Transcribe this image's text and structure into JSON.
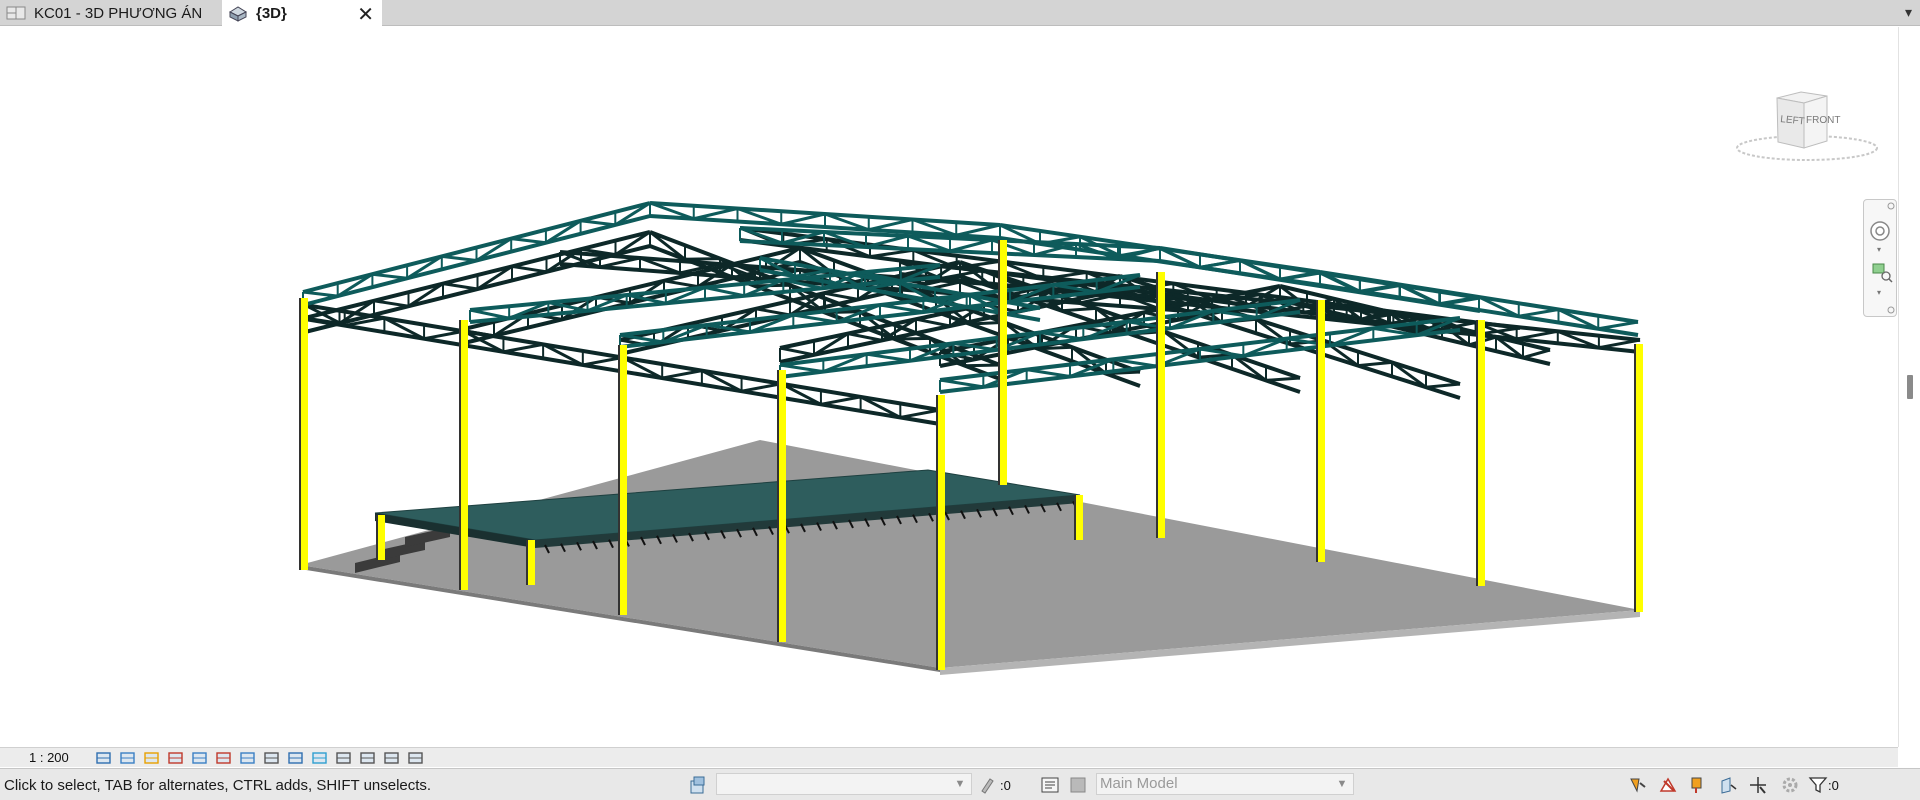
{
  "tabs": [
    {
      "label": "KC01 - 3D PHƯƠNG ÁN",
      "icon": "floor-plan-icon",
      "active": false
    },
    {
      "label": "{3D}",
      "icon": "3d-view-house-icon",
      "active": true
    }
  ],
  "viewcube": {
    "left_face": "LEFT",
    "front_face": "FRONT"
  },
  "view_control_bar": {
    "scale": "1 : 200",
    "icons": [
      "detail-level-icon",
      "visual-style-icon",
      "sun-path-icon",
      "shadows-icon",
      "rendering-dialog-icon",
      "crop-view-icon",
      "show-crop-region-icon",
      "unlock-3d-view-icon",
      "temporary-hide-isolate-icon",
      "reveal-hidden-elements-icon",
      "temporary-view-properties-icon",
      "show-analytical-model-icon",
      "highlight-displacement-icon",
      "reveal-constraints-icon"
    ]
  },
  "status_bar": {
    "message": "Click to select, TAB for alternates, CTRL adds, SHIFT unselects.",
    "workset_value": "",
    "editable_only_count": ":0",
    "design_option": "Main Model",
    "filter_count": ":0"
  },
  "colors": {
    "column": "#ffff00",
    "truss_front": "#0e5b5b",
    "truss_back": "#0d2828",
    "floor": "#9a9a9a",
    "deck": "#2e5d5d"
  }
}
